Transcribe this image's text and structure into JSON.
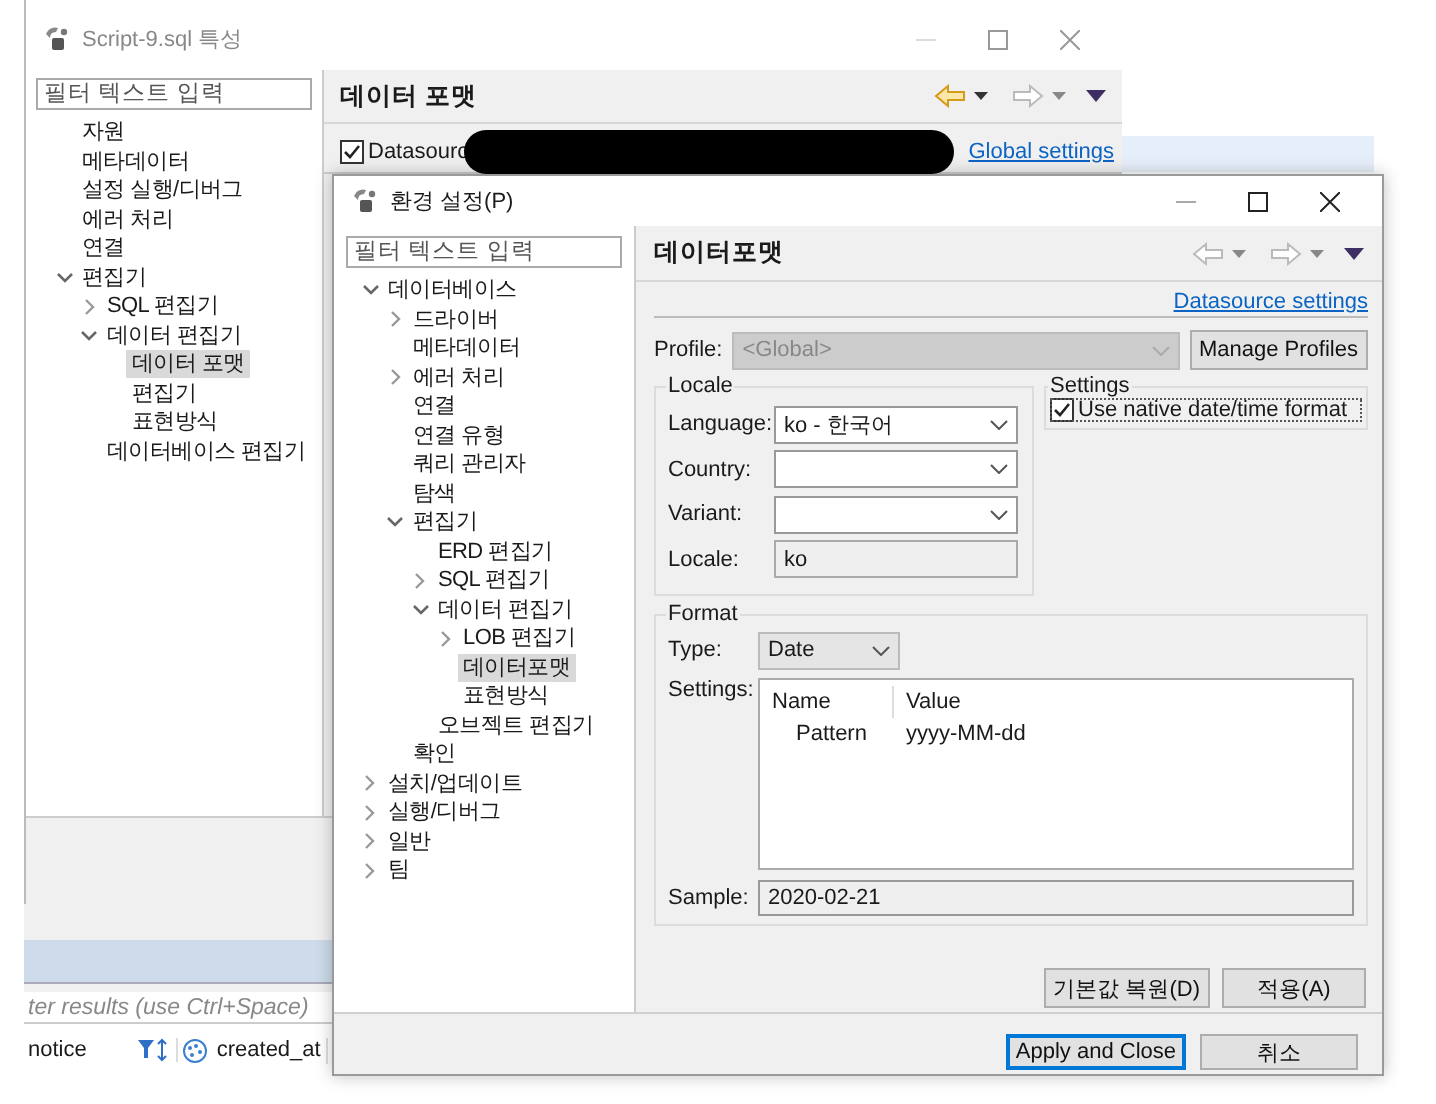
{
  "back_window": {
    "title": "Script-9.sql 특성",
    "filter": {
      "placeholder": "필터 텍스트 입력"
    },
    "tree": [
      {
        "label": "자원",
        "selected": false
      },
      {
        "label": "메타데이터",
        "selected": false
      },
      {
        "label": "설정 실행/디버그",
        "selected": false
      },
      {
        "label": "에러 처리",
        "selected": false
      },
      {
        "label": "연결",
        "selected": false
      },
      {
        "label": "편집기",
        "selected": false,
        "expanded": true,
        "children": [
          {
            "label": "SQL 편집기",
            "selected": false,
            "expanded": false
          },
          {
            "label": "데이터 편집기",
            "selected": false,
            "expanded": true,
            "children": [
              {
                "label": "데이터 포맷",
                "selected": true
              },
              {
                "label": "편집기",
                "selected": false
              },
              {
                "label": "표현방식",
                "selected": false
              }
            ]
          },
          {
            "label": "데이터베이스 편집기",
            "selected": false
          }
        ]
      }
    ],
    "page_title": "데이터 포맷",
    "nav": {
      "back_enabled": true,
      "forward_enabled": false
    },
    "datasource_checkbox": {
      "label": "Datasourc",
      "checked": true
    },
    "global_settings_link": "Global settings"
  },
  "background_app": {
    "filter": {
      "placeholder": "ter results (use Ctrl+Space)"
    },
    "columns": [
      "notice",
      "created_at"
    ]
  },
  "preferences_dialog": {
    "title": "환경 설정(P)",
    "filter": {
      "placeholder": "필터 텍스트 입력"
    },
    "tree": [
      {
        "label": "데이터베이스",
        "selected": false,
        "expanded": true,
        "children": [
          {
            "label": "드라이버",
            "selected": false,
            "expanded": false
          },
          {
            "label": "메타데이터",
            "selected": false
          },
          {
            "label": "에러 처리",
            "selected": false,
            "expanded": false
          },
          {
            "label": "연결",
            "selected": false
          },
          {
            "label": "연결 유형",
            "selected": false
          },
          {
            "label": "쿼리 관리자",
            "selected": false
          },
          {
            "label": "탐색",
            "selected": false
          },
          {
            "label": "편집기",
            "selected": false,
            "expanded": true,
            "children": [
              {
                "label": "ERD 편집기",
                "selected": false
              },
              {
                "label": "SQL 편집기",
                "selected": false,
                "expanded": false
              },
              {
                "label": "데이터 편집기",
                "selected": false,
                "expanded": true,
                "children": [
                  {
                    "label": "LOB 편집기",
                    "selected": false,
                    "expanded": false
                  },
                  {
                    "label": "데이터포맷",
                    "selected": true
                  },
                  {
                    "label": "표현방식",
                    "selected": false
                  }
                ]
              },
              {
                "label": "오브젝트 편집기",
                "selected": false
              }
            ]
          },
          {
            "label": "확인",
            "selected": false
          }
        ]
      },
      {
        "label": "설치/업데이트",
        "selected": false,
        "expanded": false
      },
      {
        "label": "실행/디버그",
        "selected": false,
        "expanded": false
      },
      {
        "label": "일반",
        "selected": false,
        "expanded": false
      },
      {
        "label": "팀",
        "selected": false,
        "expanded": false
      }
    ],
    "page_title": "데이터포맷",
    "nav": {
      "back_enabled": false,
      "forward_enabled": false
    },
    "datasource_settings_link": "Datasource settings",
    "profile": {
      "label": "Profile:",
      "value": "<Global>",
      "disabled": true
    },
    "manage_profiles_button": "Manage Profiles",
    "locale": {
      "title": "Locale",
      "fields": [
        {
          "label": "Language:",
          "kind": "dropdown",
          "value": "ko - 한국어"
        },
        {
          "label": "Country:",
          "kind": "dropdown"
        },
        {
          "label": "Variant:",
          "kind": "dropdown"
        },
        {
          "label": "Locale:",
          "kind": "readonly",
          "value": "ko"
        }
      ]
    },
    "settings": {
      "title": "Settings",
      "native_format": {
        "label": "Use native date/time format",
        "checked": true
      }
    },
    "format": {
      "title": "Format",
      "type": {
        "label": "Type:",
        "value": "Date"
      },
      "settings_label": "Settings:",
      "table": {
        "columns": [
          "Name",
          "Value"
        ],
        "rows": [
          [
            "Pattern",
            "yyyy-MM-dd"
          ]
        ]
      },
      "sample": {
        "label": "Sample:",
        "value": "2020-02-21"
      }
    },
    "restore_defaults_button": "기본값 복원(D)",
    "apply_button": "적용(A)",
    "apply_close_button": "Apply and Close",
    "cancel_button": "취소"
  }
}
